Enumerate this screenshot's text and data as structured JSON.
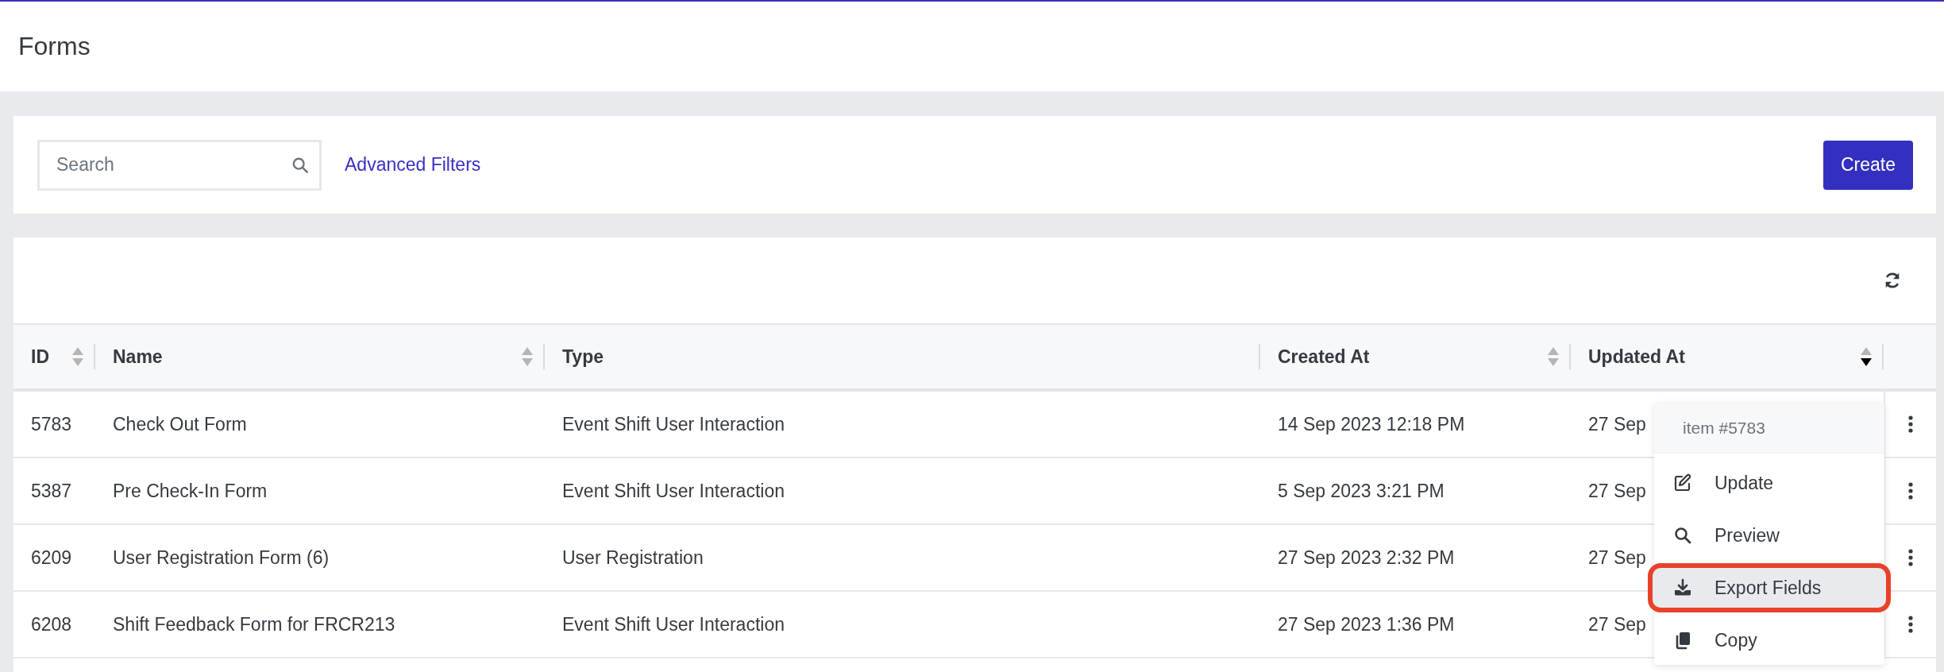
{
  "page_title": "Forms",
  "filters": {
    "search": {
      "placeholder": "Search"
    },
    "advanced_link": "Advanced Filters",
    "create_button": "Create"
  },
  "table": {
    "columns": [
      {
        "label": "ID",
        "sortable": true,
        "sorted_descending": false
      },
      {
        "label": "Name",
        "sortable": true,
        "sorted_descending": false
      },
      {
        "label": "Type",
        "sortable": false
      },
      {
        "label": "Created At",
        "sortable": true,
        "sorted_descending": false
      },
      {
        "label": "Updated At",
        "sortable": true,
        "sorted_descending": true
      }
    ],
    "rows": [
      {
        "cells": [
          "5783",
          "Check Out Form",
          "Event Shift User Interaction",
          "14 Sep 2023 12:18 PM",
          "27 Sep"
        ]
      },
      {
        "cells": [
          "5387",
          "Pre Check-In Form",
          "Event Shift User Interaction",
          "5 Sep 2023 3:21 PM",
          "27 Sep"
        ]
      },
      {
        "cells": [
          "6209",
          "User Registration Form (6)",
          "User Registration",
          "27 Sep 2023 2:32 PM",
          "27 Sep"
        ]
      },
      {
        "cells": [
          "6208",
          "Shift Feedback Form for FRCR213",
          "Event Shift User Interaction",
          "27 Sep 2023 1:36 PM",
          "27 Sep"
        ]
      }
    ]
  },
  "row_menu": {
    "title": "item #5783",
    "items": [
      {
        "kind": "edit",
        "label": "Update",
        "selected": false
      },
      {
        "kind": "preview",
        "label": "Preview",
        "selected": false
      },
      {
        "kind": "export",
        "label": "Export Fields",
        "selected": true
      },
      {
        "kind": "copy",
        "label": "Copy",
        "selected": false
      }
    ]
  }
}
